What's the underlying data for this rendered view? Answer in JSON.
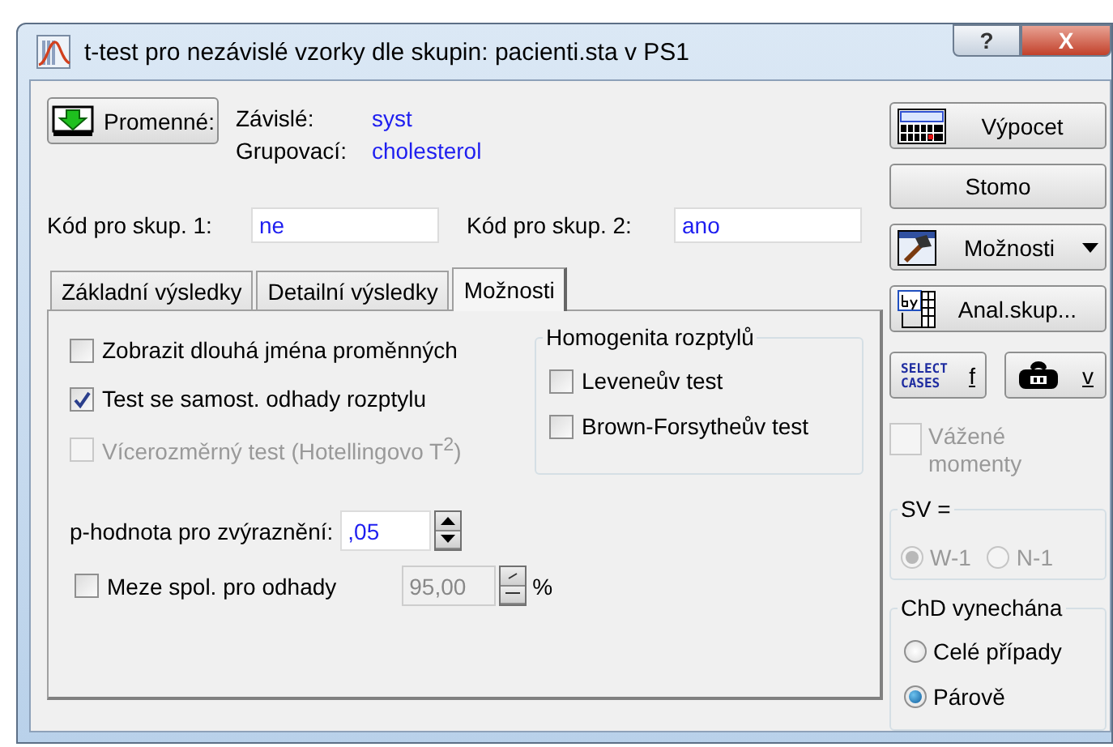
{
  "window": {
    "title": "t-test pro nezávislé vzorky dle skupin: pacienti.sta v PS1",
    "help": "?",
    "close": "X"
  },
  "variables": {
    "button": "Promenné:",
    "rows": [
      {
        "label": "Závislé:",
        "value": "syst"
      },
      {
        "label": "Grupovací:",
        "value": "cholesterol"
      }
    ]
  },
  "codes": [
    {
      "label": "Kód pro skup. 1:",
      "value": "ne"
    },
    {
      "label": "Kód pro skup. 2:",
      "value": "ano"
    }
  ],
  "tabs": [
    {
      "label": "Základní výsledky",
      "selected": false
    },
    {
      "label": "Detailní výsledky",
      "selected": false
    },
    {
      "label": "Možnosti",
      "selected": true
    }
  ],
  "options": {
    "checkboxes": [
      {
        "label": "Zobrazit dlouhá jména proměnných",
        "checked": false,
        "disabled": false
      },
      {
        "label": "Test se samost. odhady rozptylu",
        "checked": true,
        "disabled": false
      },
      {
        "label": "Vícerozměrný test (Hotellingovo T$^{2}$)",
        "checked": false,
        "disabled": true
      }
    ],
    "homogeneity": {
      "title": "Homogenita rozptylů",
      "checkboxes": [
        {
          "label": "Leveneův test",
          "checked": false
        },
        {
          "label": "Brown-Forsytheův test",
          "checked": false
        }
      ]
    },
    "p_value": {
      "label": "p-hodnota pro zvýraznění:",
      "value": ",05"
    },
    "confidence": {
      "label": "Meze spol. pro odhady",
      "checked": false,
      "value": "95,00",
      "unit": "%",
      "disabled": true
    }
  },
  "side_buttons": [
    {
      "kind": "summary",
      "label": "Výpocet"
    },
    {
      "kind": "plain",
      "label": "Stomo"
    },
    {
      "kind": "menu",
      "label": "Možnosti"
    },
    {
      "kind": "by",
      "label": "Anal.skup..."
    }
  ],
  "small_buttons": [
    {
      "kind": "select",
      "icon_text": "SELECT CASES",
      "label": "f"
    },
    {
      "kind": "weight",
      "label": "v"
    }
  ],
  "weighted": {
    "label": "Vážené momenty",
    "checked": false,
    "disabled": true
  },
  "sv": {
    "title": "SV =",
    "disabled": true,
    "options": [
      {
        "label": "W-1",
        "selected": true
      },
      {
        "label": "N-1",
        "selected": false
      }
    ]
  },
  "missing": {
    "title": "ChD vynechána",
    "options": [
      {
        "label": "Celé případy",
        "selected": false
      },
      {
        "label": "Párově",
        "selected": true
      }
    ]
  }
}
